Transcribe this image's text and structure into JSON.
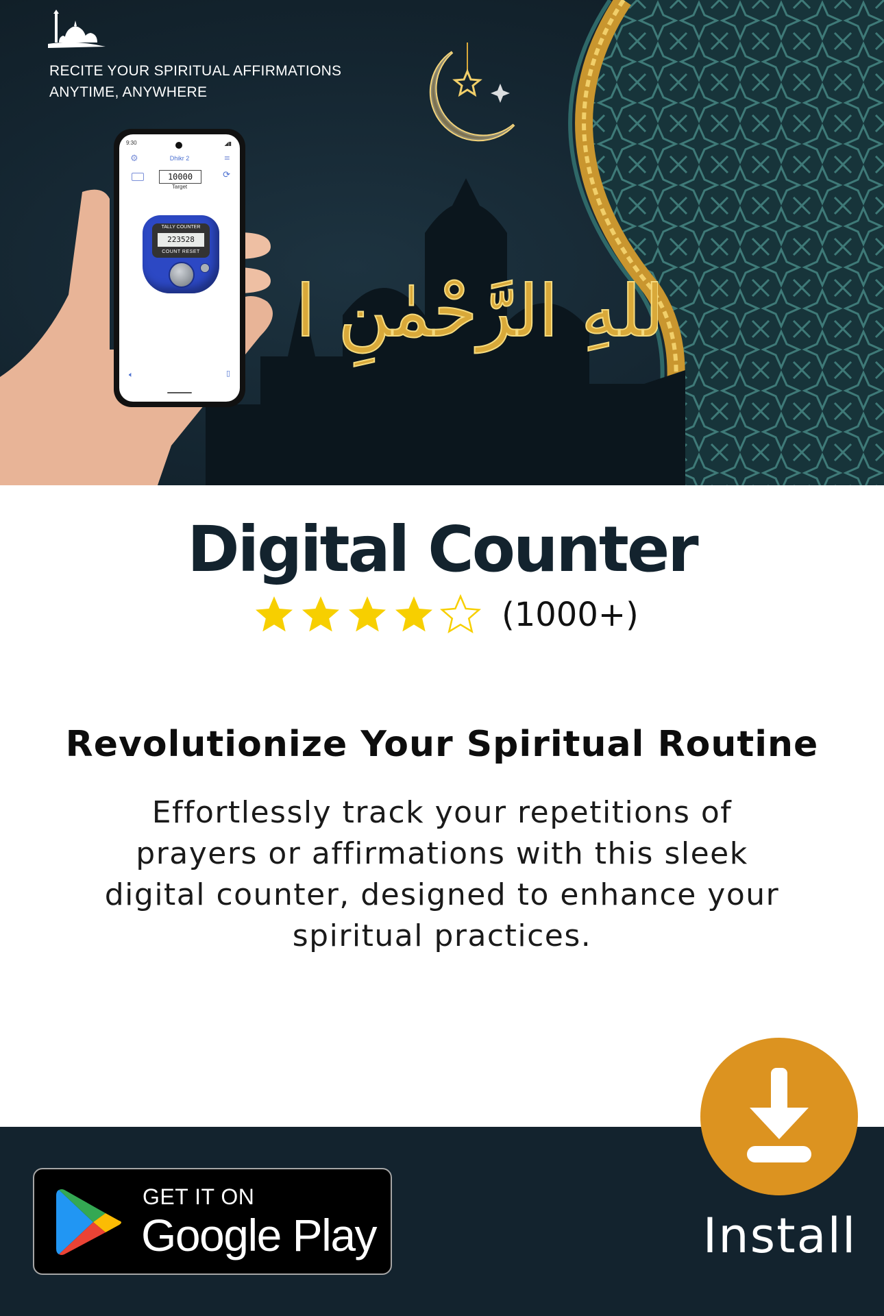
{
  "hero": {
    "tagline_line1": "RECITE YOUR SPIRITUAL AFFIRMATIONS",
    "tagline_line2": "ANYTIME, ANYWHERE",
    "calligraphy": "بِسْمِ اللهِ الرَّحْمٰنِ الرَّحِيْمِ",
    "phone": {
      "status_time": "9:30",
      "title": "Dhikr 2",
      "target_value": "10000",
      "target_label": "Target",
      "tally_top_label": "TALLY  COUNTER",
      "tally_display": "223528",
      "tally_bottom_label": "COUNT   RESET"
    }
  },
  "app": {
    "title": "Digital Counter",
    "rating_stars": 4,
    "rating_max": 5,
    "rating_count": "(1000+)"
  },
  "content": {
    "headline": "Revolutionize Your Spiritual Routine",
    "description": "Effortlessly track your repetitions of prayers or affirmations with this sleek digital counter, designed to enhance your spiritual practices."
  },
  "footer": {
    "store_small": "GET IT ON",
    "store_big": "Google Play",
    "install_label": "Install"
  },
  "colors": {
    "hero_bg": "#142530",
    "footer_bg": "#13232e",
    "star": "#f7cf00",
    "install": "#dc9320",
    "gold": "#d9a93a",
    "pattern": "#2c5c5e"
  }
}
